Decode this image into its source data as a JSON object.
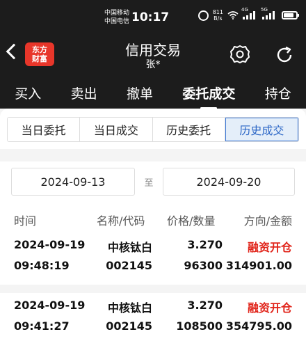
{
  "status_bar": {
    "carrier_1": "中国移动",
    "carrier_2": "中国电信",
    "time": "10:17",
    "net_speed_value": "811",
    "net_speed_unit": "B/s",
    "signal_1": "4G",
    "signal_2": "5G"
  },
  "header": {
    "logo_line1": "东方",
    "logo_line2": "财富",
    "title": "信用交易",
    "subtitle": "张*"
  },
  "main_tabs": [
    {
      "label": "买入"
    },
    {
      "label": "卖出"
    },
    {
      "label": "撤单"
    },
    {
      "label": "委托成交",
      "active": true
    },
    {
      "label": "持仓"
    }
  ],
  "sub_tabs": [
    {
      "label": "当日委托"
    },
    {
      "label": "当日成交"
    },
    {
      "label": "历史委托"
    },
    {
      "label": "历史成交",
      "active": true
    }
  ],
  "date_filter": {
    "start": "2024-09-13",
    "separator": "至",
    "end": "2024-09-20"
  },
  "columns": {
    "time": "时间",
    "name_code": "名称/代码",
    "price_qty": "价格/数量",
    "dir_amount": "方向/金额"
  },
  "records": [
    {
      "date": "2024-09-19",
      "time": "09:48:19",
      "name": "中核钛白",
      "code": "002145",
      "price": "3.270",
      "qty": "96300",
      "direction": "融资开仓",
      "amount": "314901.00"
    },
    {
      "date": "2024-09-19",
      "time": "09:41:27",
      "name": "中核钛白",
      "code": "002145",
      "price": "3.270",
      "qty": "108500",
      "direction": "融资开仓",
      "amount": "354795.00"
    }
  ],
  "colors": {
    "header_bg": "#1c1c1c",
    "accent_blue": "#2b66c6",
    "direction_red": "#e1251b"
  }
}
